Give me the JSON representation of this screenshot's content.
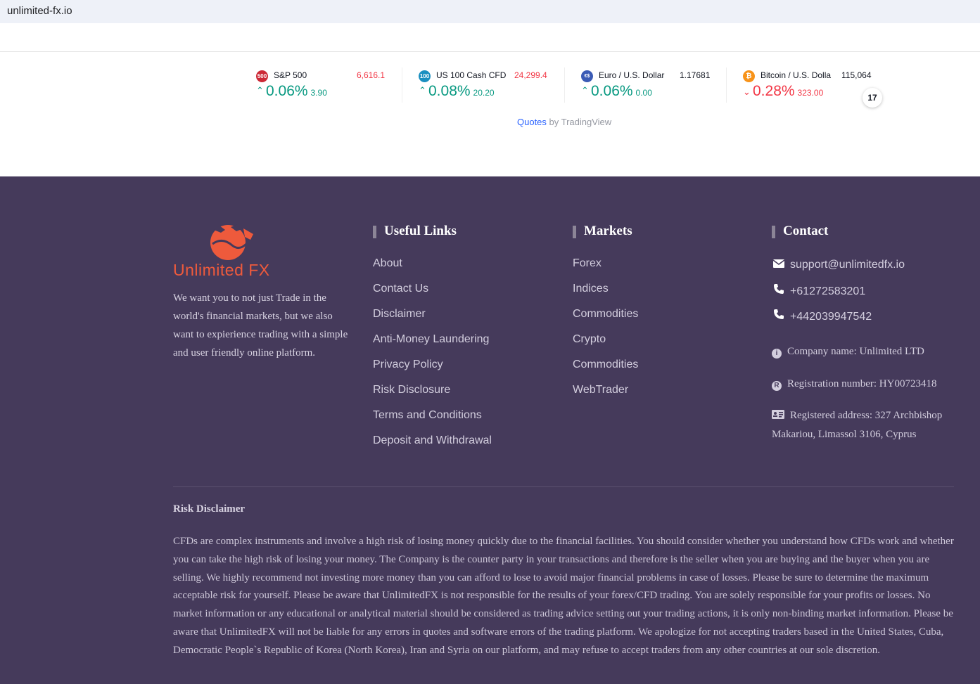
{
  "browser": {
    "url": "unlimited-fx.io"
  },
  "ticker": {
    "items": [
      {
        "badge": "500",
        "badge_color": "#cc2936",
        "name": "S&P 500",
        "price": "6,616.1",
        "price_dir": "down",
        "direction": "up",
        "change_pct": "0.06%",
        "change_abs": "3.90"
      },
      {
        "badge": "100",
        "badge_color": "#1a8fc0",
        "name": "US 100 Cash CFD",
        "price": "24,299.4",
        "price_dir": "down",
        "direction": "up",
        "change_pct": "0.08%",
        "change_abs": "20.20"
      },
      {
        "badge": "€$",
        "badge_color": "#3b5bb5",
        "name": "Euro / U.S. Dollar",
        "price": "1.17681",
        "price_dir": "neutral",
        "direction": "up",
        "change_pct": "0.06%",
        "change_abs": "0.00"
      },
      {
        "badge": "₿",
        "badge_color": "#f7931a",
        "name": "Bitcoin / U.S. Dolla",
        "price": "115,064",
        "price_dir": "neutral",
        "direction": "down",
        "change_pct": "0.28%",
        "change_abs": "323.00"
      }
    ],
    "attribution_link": "Quotes",
    "attribution_rest": " by TradingView",
    "logo_text": "17"
  },
  "footer": {
    "brand": "Unlimited FX",
    "about": "We want you to not just Trade in the world's financial markets, but we also want to expierience trading with a simple and user friendly online platform.",
    "useful_links": {
      "title": "Useful Links",
      "items": [
        "About",
        "Contact Us",
        "Disclaimer",
        "Anti-Money Laundering",
        "Privacy Policy",
        "Risk Disclosure",
        "Terms and Conditions",
        "Deposit and Withdrawal"
      ]
    },
    "markets": {
      "title": "Markets",
      "items": [
        "Forex",
        "Indices",
        "Commodities",
        "Crypto",
        "Commodities",
        "WebTrader"
      ]
    },
    "contact": {
      "title": "Contact",
      "email": "support@unlimitedfx.io",
      "phone1": "+61272583201",
      "phone2": "+442039947542",
      "company": "Company name: Unlimited LTD",
      "registration": "Registration number: HY00723418",
      "address": "Registered address: 327 Archbishop Makariou, Limassol 3106, Cyprus"
    },
    "risk": {
      "title": "Risk Disclaimer",
      "text": "CFDs are complex instruments and involve a high risk of losing money quickly due to the financial facilities. You should consider whether you understand how CFDs work and whether you can take the high risk of losing your money. The Company is the counter party in your transactions and therefore is the seller when you are buying and the buyer when you are selling. We highly recommend not investing more money than you can afford to lose to avoid major financial problems in case of losses. Please be sure to determine the maximum acceptable risk for yourself. Please be aware that UnlimitedFX is not responsible for the results of your forex/CFD trading. You are solely responsible for your profits or losses. No market information or any educational or analytical material should be considered as trading advice setting out your trading actions, it is only non-binding market information. Please be aware that UnlimitedFX will not be liable for any errors in quotes and software errors of the trading platform. We apologize for not accepting traders based in the United States, Cuba, Democratic People`s Republic of Korea (North Korea), Iran and Syria on our platform, and may refuse to accept traders from any other countries at our sole discretion."
    }
  }
}
